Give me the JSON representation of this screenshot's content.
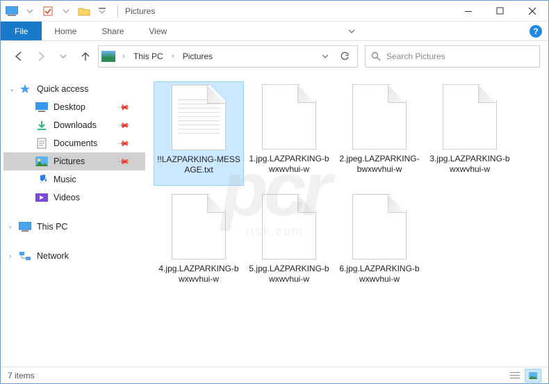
{
  "window": {
    "title": "Pictures"
  },
  "ribbon": {
    "file": "File",
    "tabs": [
      "Home",
      "Share",
      "View"
    ]
  },
  "breadcrumb": {
    "segments": [
      "This PC",
      "Pictures"
    ]
  },
  "search": {
    "placeholder": "Search Pictures"
  },
  "sidebar": {
    "quick_access": "Quick access",
    "items": [
      {
        "label": "Desktop",
        "icon": "desktop"
      },
      {
        "label": "Downloads",
        "icon": "downloads"
      },
      {
        "label": "Documents",
        "icon": "documents"
      },
      {
        "label": "Pictures",
        "icon": "pictures",
        "selected": true
      },
      {
        "label": "Music",
        "icon": "music"
      },
      {
        "label": "Videos",
        "icon": "videos"
      }
    ],
    "this_pc": "This PC",
    "network": "Network"
  },
  "files": [
    {
      "name": "!!LAZPARKING-MESSAGE.txt",
      "type": "text",
      "selected": true
    },
    {
      "name": "1.jpg.LAZPARKING-bwxwvhui-w",
      "type": "generic"
    },
    {
      "name": "2.jpeg.LAZPARKING-bwxwvhui-w",
      "type": "generic"
    },
    {
      "name": "3.jpg.LAZPARKING-bwxwvhui-w",
      "type": "generic"
    },
    {
      "name": "4.jpg.LAZPARKING-bwxwvhui-w",
      "type": "generic"
    },
    {
      "name": "5.jpg.LAZPARKING-bwxwvhui-w",
      "type": "generic"
    },
    {
      "name": "6.jpg.LAZPARKING-bwxwvhui-w",
      "type": "generic"
    }
  ],
  "status": {
    "count_label": "7 items"
  },
  "watermark": {
    "main": "pcr",
    "sub": "risk.com"
  }
}
